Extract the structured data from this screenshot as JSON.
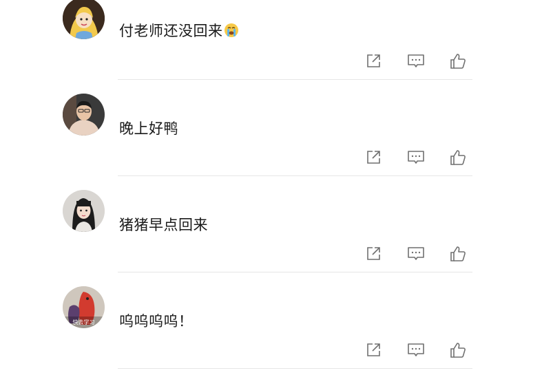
{
  "comments": [
    {
      "text": "付老师还没回来",
      "emoji": "crying-face-emoji",
      "avatar": "avatar-cartoon-girl"
    },
    {
      "text": "晚上好鸭",
      "avatar": "avatar-man-photo"
    },
    {
      "text": "猪猪早点回来",
      "avatar": "avatar-girl-photo"
    },
    {
      "text": "呜呜呜呜！",
      "avatar": "avatar-toys",
      "avatar_caption": "快去学习"
    }
  ],
  "icons": {
    "share": "share-icon",
    "reply": "comment-icon",
    "like": "thumbs-up-icon"
  },
  "colors": {
    "icon": "#6f6f6f",
    "text": "#1a1a1a",
    "divider": "#e6e6e6"
  }
}
